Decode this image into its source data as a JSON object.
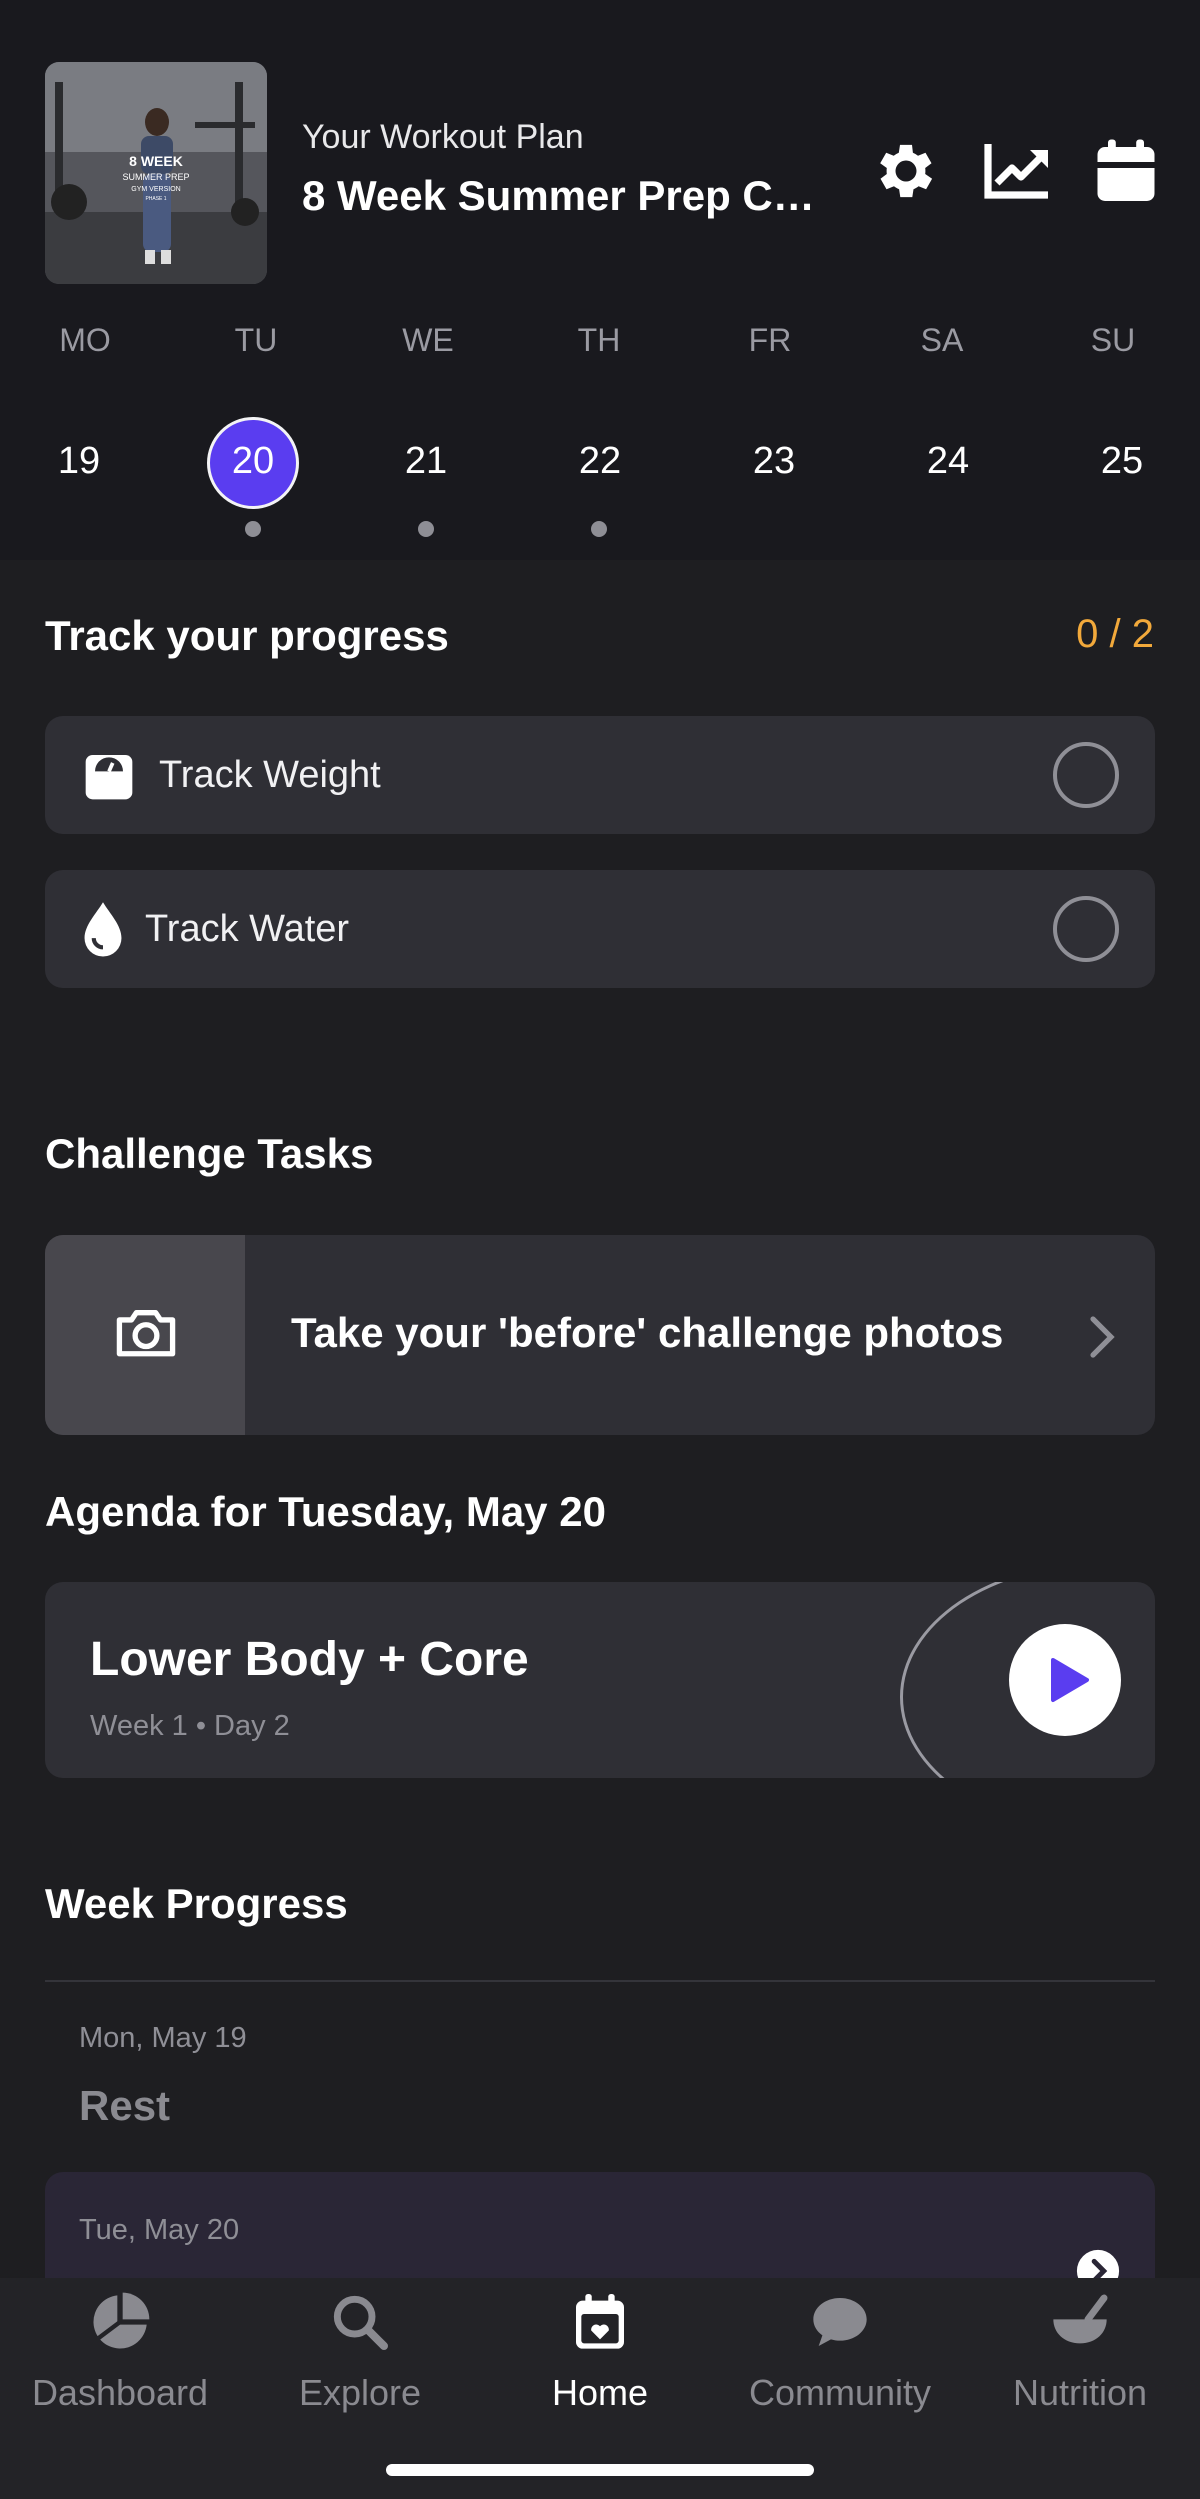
{
  "header": {
    "thumbnail_text": [
      "8 WEEK",
      "SUMMER PREP",
      "GYM VERSION",
      "PHASE 1"
    ],
    "subtitle": "Your Workout Plan",
    "title": "8 Week Summer Prep Ch…",
    "icons": [
      "gear-icon",
      "chart-icon",
      "calendar-icon"
    ]
  },
  "week": {
    "days": [
      {
        "label": "MO",
        "num": "19",
        "dot": false,
        "selected": false
      },
      {
        "label": "TU",
        "num": "20",
        "dot": true,
        "selected": true
      },
      {
        "label": "WE",
        "num": "21",
        "dot": true,
        "selected": false
      },
      {
        "label": "TH",
        "num": "22",
        "dot": true,
        "selected": false
      },
      {
        "label": "FR",
        "num": "23",
        "dot": false,
        "selected": false
      },
      {
        "label": "SA",
        "num": "24",
        "dot": false,
        "selected": false
      },
      {
        "label": "SU",
        "num": "25",
        "dot": false,
        "selected": false
      }
    ],
    "accent": "#5a3df0"
  },
  "progress": {
    "title": "Track your progress",
    "count": "0 / 2",
    "count_color": "#f2a93b",
    "items": [
      {
        "label": "Track Weight",
        "icon": "scale-icon"
      },
      {
        "label": "Track Water",
        "icon": "water-drop-icon"
      }
    ]
  },
  "tasks": {
    "title": "Challenge Tasks",
    "item": {
      "label": "Take your 'before' challenge photos",
      "icon": "camera-icon"
    }
  },
  "agenda": {
    "title": "Agenda for Tuesday, May 20",
    "workout_title": "Lower Body + Core",
    "workout_sub": "Week 1 • Day 2"
  },
  "week_progress": {
    "title": "Week Progress",
    "entries": [
      {
        "date": "Mon, May 19",
        "label": "Rest"
      },
      {
        "date": "Tue, May 20"
      }
    ]
  },
  "nav": {
    "items": [
      {
        "label": "Dashboard",
        "icon": "pie-chart-icon"
      },
      {
        "label": "Explore",
        "icon": "search-icon"
      },
      {
        "label": "Home",
        "icon": "calendar-heart-icon",
        "active": true
      },
      {
        "label": "Community",
        "icon": "chat-bubble-icon"
      },
      {
        "label": "Nutrition",
        "icon": "mortar-bowl-icon"
      }
    ]
  }
}
